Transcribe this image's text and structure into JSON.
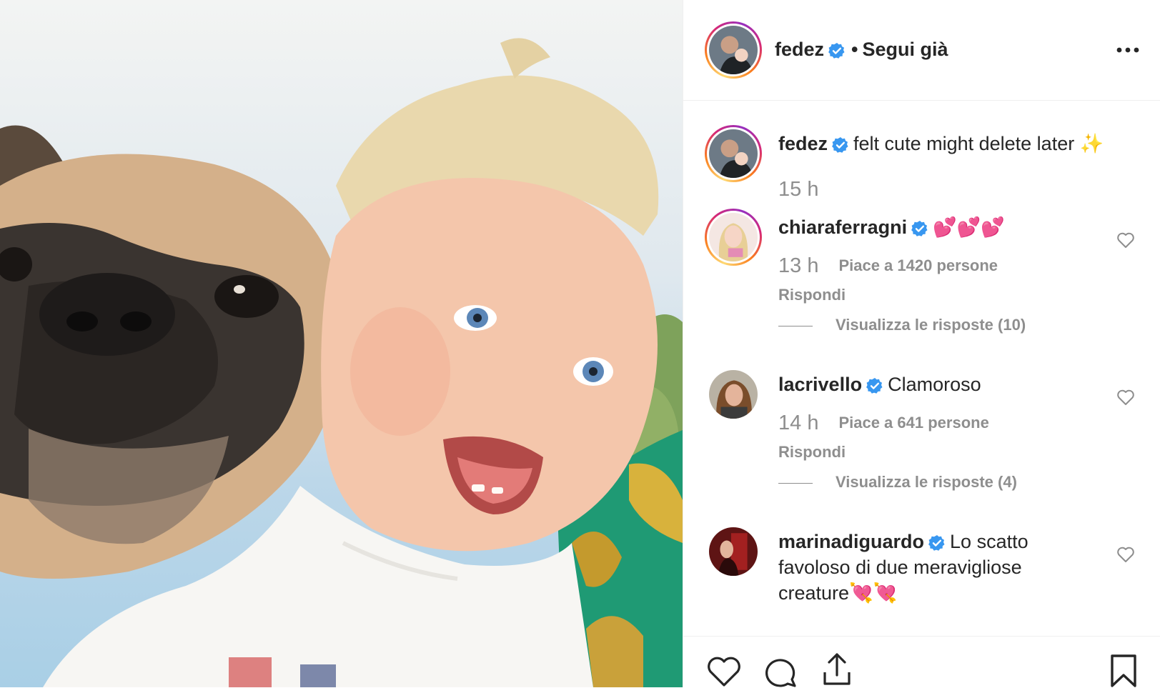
{
  "post": {
    "author": "fedez",
    "separator": "•",
    "follow_status": "Segui già",
    "more_icon": "more-options-icon"
  },
  "caption": {
    "username": "fedez",
    "text": "felt cute might delete later ✨",
    "time": "15 h"
  },
  "comments": [
    {
      "username": "chiaraferragni",
      "text": "💕💕💕",
      "time": "13 h",
      "likes": "Piace a 1420 persone",
      "reply": "Rispondi",
      "view_replies": "Visualizza le risposte (10)"
    },
    {
      "username": "lacrivello",
      "text": "Clamoroso",
      "time": "14 h",
      "likes": "Piace a 641 persone",
      "reply": "Rispondi",
      "view_replies": "Visualizza le risposte (4)"
    },
    {
      "username": "marinadiguardo",
      "text": "Lo scatto favoloso di due meravigliose creature💘💘"
    }
  ],
  "colors": {
    "verified_blue": "#3897f0",
    "muted_text": "#8e8e8e",
    "primary_text": "#262626",
    "divider": "#efefef"
  },
  "icons": {
    "like": "heart-icon",
    "comment": "comment-icon",
    "share": "share-icon",
    "save": "bookmark-icon",
    "verified": "verified-badge-icon"
  }
}
